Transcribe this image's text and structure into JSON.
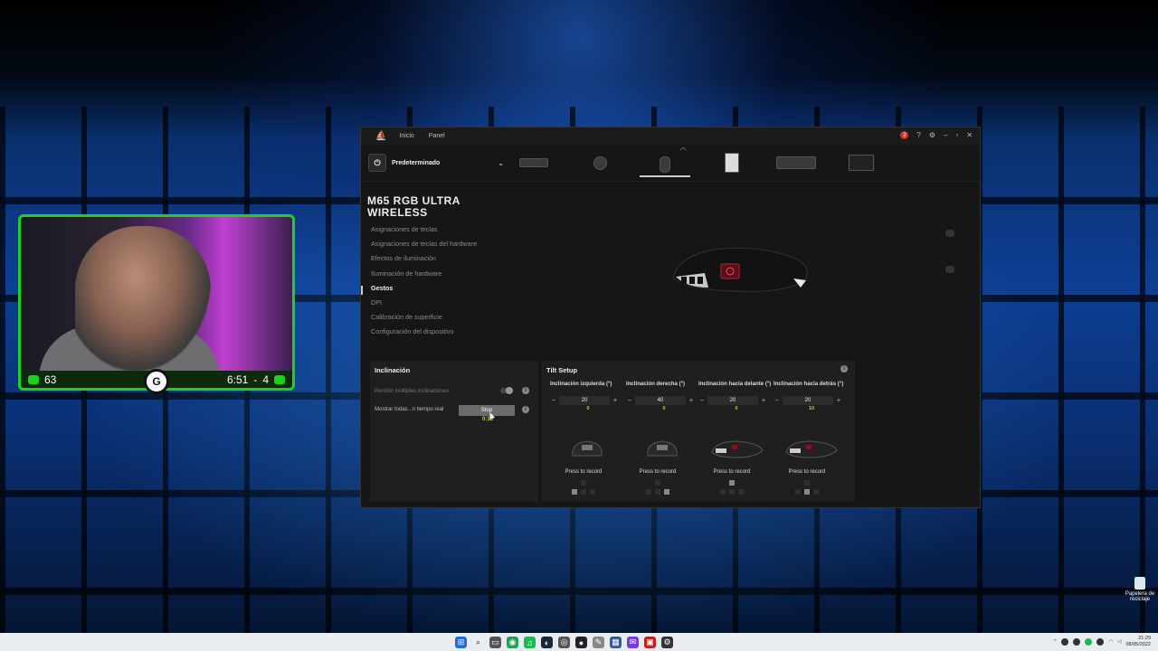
{
  "app": {
    "tabs": [
      "Inicio",
      "Panel"
    ],
    "notification_count": "2",
    "profile_name": "Predeterminado",
    "device_name_line1": "M65 RGB ULTRA",
    "device_name_line2": "WIRELESS",
    "nav": [
      "Asignaciones de teclas",
      "Asignaciones de teclas del hardware",
      "Efectos de iluminación",
      "Iluminación de hardware",
      "Gestos",
      "DPI",
      "Calibración de superficie",
      "Configuración del dispositivo"
    ],
    "nav_active_index": 4
  },
  "inclinacion": {
    "title": "Inclinación",
    "multi_label": "Permitir múltiples inclinaciones",
    "multi_enabled": false,
    "realtime_label": "Mostrar todas...n tiempo real",
    "stop_label": "Stop",
    "counter": "0:15"
  },
  "tilt": {
    "title": "Tilt Setup",
    "columns": [
      {
        "label": "Inclinación izquierda (°)",
        "value": "20",
        "live": "0",
        "record": "Press to record"
      },
      {
        "label": "Inclinación derecha (°)",
        "value": "40",
        "live": "0",
        "record": "Press to record"
      },
      {
        "label": "Inclinación hacia delante (°)",
        "value": "20",
        "live": "0",
        "record": "Press to record"
      },
      {
        "label": "Inclinación hacia detrás (°)",
        "value": "20",
        "live": "10",
        "record": "Press to record"
      }
    ],
    "info_icon": "info-icon"
  },
  "webcam": {
    "left_count": "63",
    "time": "6:51",
    "right_count": "4",
    "separator": "-"
  },
  "desktop": {
    "recycle_label_line1": "Papelera de",
    "recycle_label_line2": "reciclaje"
  },
  "taskbar": {
    "time": "21:29",
    "date": "08/05/2022"
  }
}
